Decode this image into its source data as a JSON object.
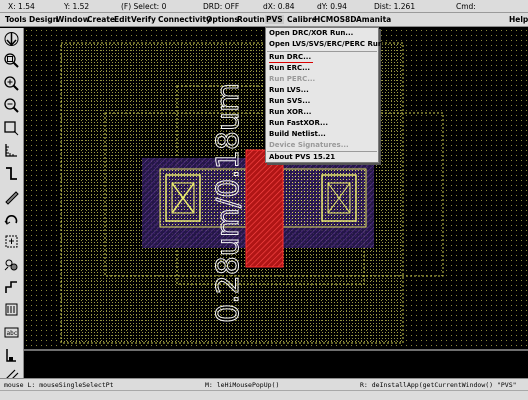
{
  "status": {
    "x": "X: 1.54",
    "y": "Y: 1.52",
    "select": "(F) Select: 0",
    "drd": "DRD: OFF",
    "dx": "dX: 0.84",
    "dy": "dY: 0.94",
    "dist": "Dist: 1.261",
    "cmd": "Cmd:"
  },
  "menu": [
    "Tools",
    "Design",
    "Window",
    "Create",
    "Edit",
    "Verify",
    "Connectivity",
    "Options",
    "Routing",
    "PVS",
    "Calibre",
    "HCMOS8D",
    "Amanita",
    "Help"
  ],
  "dropdown": {
    "items": [
      {
        "label": "Open DRC/XOR Run...",
        "enabled": true
      },
      {
        "label": "Open LVS/SVS/ERC/PERC Run...",
        "enabled": true
      },
      {
        "label": "Run DRC...",
        "enabled": true
      },
      {
        "label": "Run ERC...",
        "enabled": true
      },
      {
        "label": "Run PERC...",
        "enabled": false
      },
      {
        "label": "Run LVS...",
        "enabled": true
      },
      {
        "label": "Run SVS...",
        "enabled": true
      },
      {
        "label": "Run XOR...",
        "enabled": true
      },
      {
        "label": "Run FastXOR...",
        "enabled": true
      },
      {
        "label": "Build Netlist...",
        "enabled": true
      },
      {
        "label": "Device Signatures...",
        "enabled": false
      },
      {
        "label": "About PVS 15.21",
        "enabled": true
      }
    ]
  },
  "layout": {
    "gate_label": "0.28um/0.18um",
    "colors": {
      "grid": "#8a8a3a",
      "poly": "#d11f1f",
      "diffusion": "#d8d85a",
      "implant": "#5a2f8f",
      "contact": "#e8e870"
    }
  },
  "bottom": {
    "mouse_l": "mouse L: mouseSingleSelectPt",
    "mouse_m": "M: leHiMousePopUp()",
    "mouse_r": "R: deInstallApp(getCurrentWindow() \"PVS\""
  },
  "icons": [
    "down-arrow-icon",
    "zoom-fit-icon",
    "zoom-in-icon",
    "zoom-out-icon",
    "rectangle-icon",
    "ruler-icon",
    "path-icon",
    "pencil-icon",
    "undo-icon",
    "pin-icon",
    "instance-icon",
    "step-icon",
    "via-icon",
    "label-icon",
    "window-icon",
    "scroll-icon"
  ]
}
